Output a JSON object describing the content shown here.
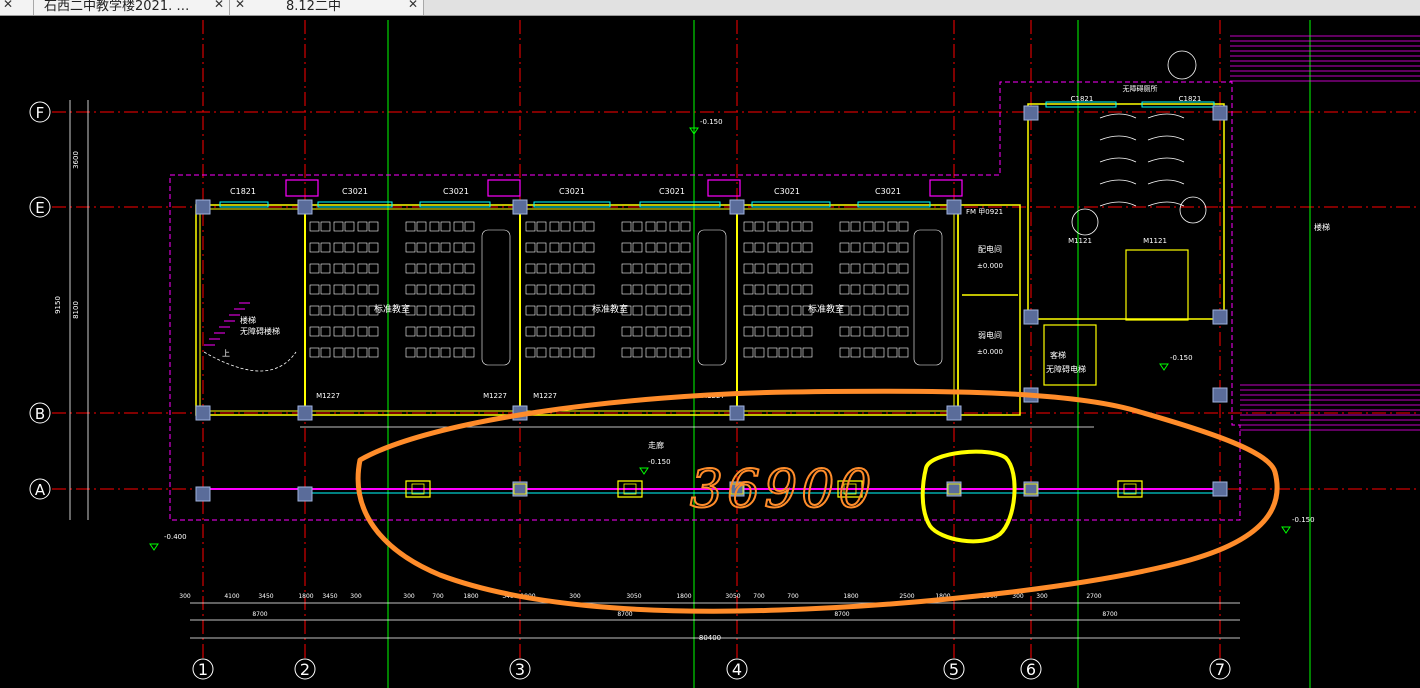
{
  "tabs": [
    {
      "label": "石西二中教学楼2021. …"
    },
    {
      "label": "8.12二中"
    }
  ],
  "grid": {
    "columns": [
      "1",
      "2",
      "3",
      "4",
      "5",
      "6",
      "7"
    ],
    "rows": [
      "F",
      "E",
      "B",
      "A"
    ]
  },
  "labels": {
    "window_c1821_a": "C1821",
    "window_c3021_1": "C3021",
    "window_c3021_2": "C3021",
    "window_c3021_3": "C3021",
    "window_c3021_4": "C3021",
    "window_c3021_5": "C3021",
    "window_c1821_b": "C1821",
    "window_c1821_c": "C1821",
    "classroom_1": "标准教室",
    "classroom_2": "标准教室",
    "classroom_3": "标准教室",
    "stair": "楼梯",
    "stair_note": "无障碍楼梯",
    "up": "上",
    "room_elec": "配电间",
    "room_weak": "弱电间",
    "room_elec_el": "±0.000",
    "room_weak_el": "±0.000",
    "door_m1227_1": "M1227",
    "door_m1227_2": "M1227",
    "door_m1227_3": "M1227",
    "door_m1227_4": "M1227",
    "door_m1121_a": "M1121",
    "door_m1121_b": "M1121",
    "elevator": "无障碍电梯",
    "elevator_room": "客梯",
    "toilet_top": "无障碍厕所",
    "corridor": "走廊",
    "el_minus_0150_a": "-0.150",
    "el_minus_0150_b": "-0.150",
    "el_minus_0150_c": "-0.150",
    "el_minus_0150_d": "-0.150",
    "el_minus_0400": "-0.400",
    "handwritten": "36900",
    "dim_total_bottom": "80400",
    "right_stair": "楼梯",
    "dim_left_top": "3600",
    "dim_left_mid": "8100",
    "dim_left_total": "9150",
    "fw_label": "FM 甲0921"
  },
  "dims_bottom": [
    "300",
    "4100",
    "3450",
    "1800",
    "3450",
    "300",
    "300",
    "700",
    "1800",
    "3450",
    "1800",
    "300",
    "3050",
    "1800",
    "3050",
    "700",
    "700",
    "1800",
    "2500",
    "1800",
    "2500",
    "300",
    "300",
    "2700"
  ],
  "dims_bottom2": [
    "8700",
    "8700",
    "8700",
    "8700"
  ],
  "colors": {
    "background": "#000000",
    "grid_red": "#ff0000",
    "wall_yellow": "#ffff00",
    "magenta": "#ff00ff",
    "cyan": "#00ffff",
    "green": "#00ff00",
    "white": "#ffffff",
    "orange_annotation": "#ff8c2a",
    "yellow_annotation": "#ffff00",
    "column_fill": "#5a6c9a"
  }
}
